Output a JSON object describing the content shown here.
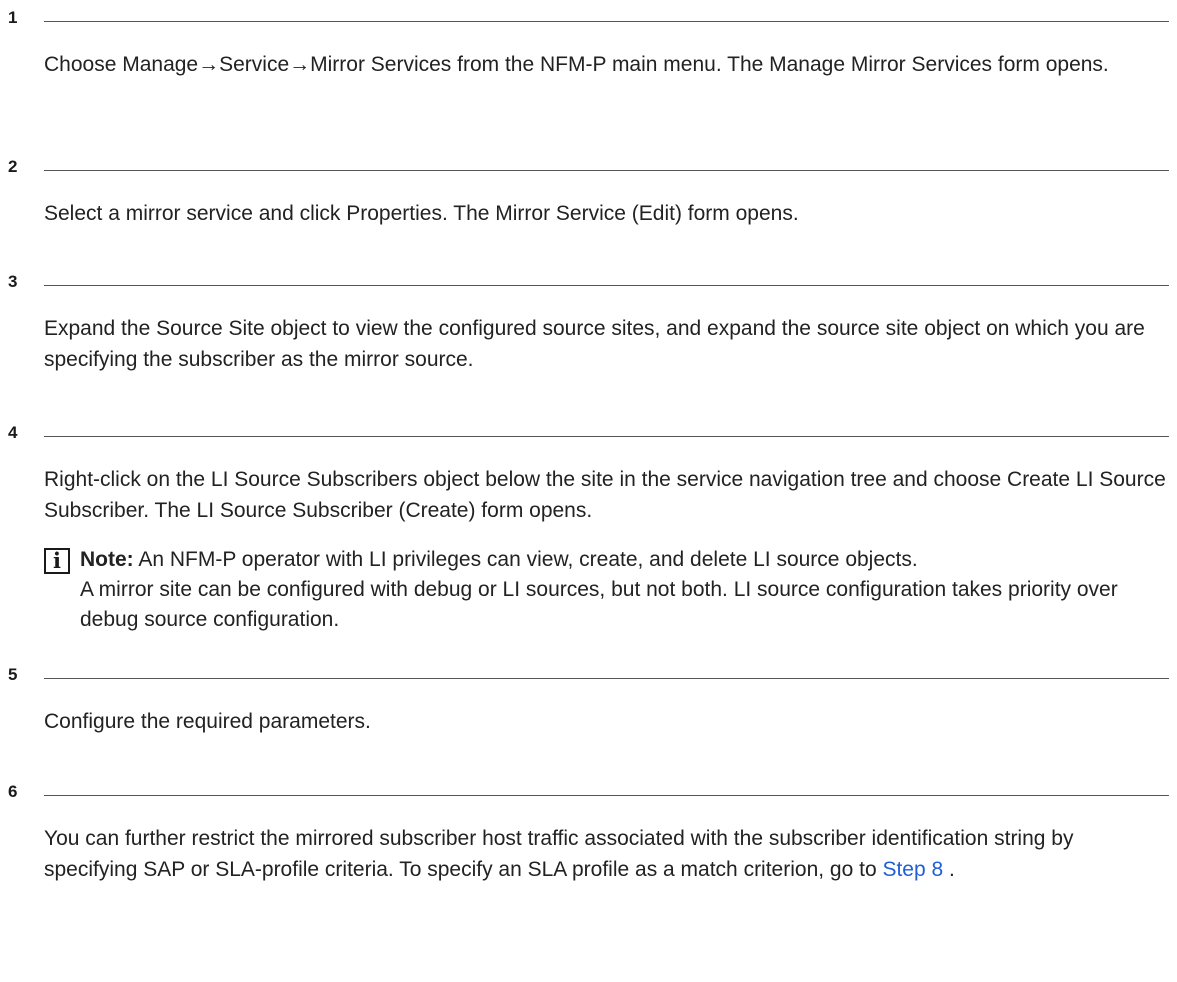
{
  "steps": [
    {
      "number": "1",
      "text": "Choose Manage→Service→Mirror Services from the NFM-P main menu. The Manage Mirror Services form opens."
    },
    {
      "number": "2",
      "text": "Select a mirror service and click Properties. The Mirror Service (Edit) form opens."
    },
    {
      "number": "3",
      "text": "Expand the Source Site object to view the configured source sites, and expand the source site object on which you are specifying the subscriber as the mirror source."
    },
    {
      "number": "4",
      "text": "Right-click on the LI Source Subscribers object below the site in the service navigation tree and choose Create LI Source Subscriber. The LI Source Subscriber (Create) form opens.",
      "note": {
        "icon": "info-icon",
        "label": "Note:",
        "text1": " An NFM-P operator with LI privileges can view, create, and delete LI source objects.",
        "text2": "A mirror site can be configured with debug or LI sources, but not both. LI source configuration takes priority over debug source configuration."
      }
    },
    {
      "number": "5",
      "text": "Configure the required parameters."
    },
    {
      "number": "6",
      "text": "You can further restrict the mirrored subscriber host traffic associated with the subscriber identification string by specifying SAP or SLA-profile criteria. To specify an SLA profile as a match criterion, go to ",
      "link": "Step 8",
      "text_after": " ."
    }
  ],
  "colors": {
    "text": "#222222",
    "rule": "#555555",
    "link": "#1f5fd6"
  }
}
